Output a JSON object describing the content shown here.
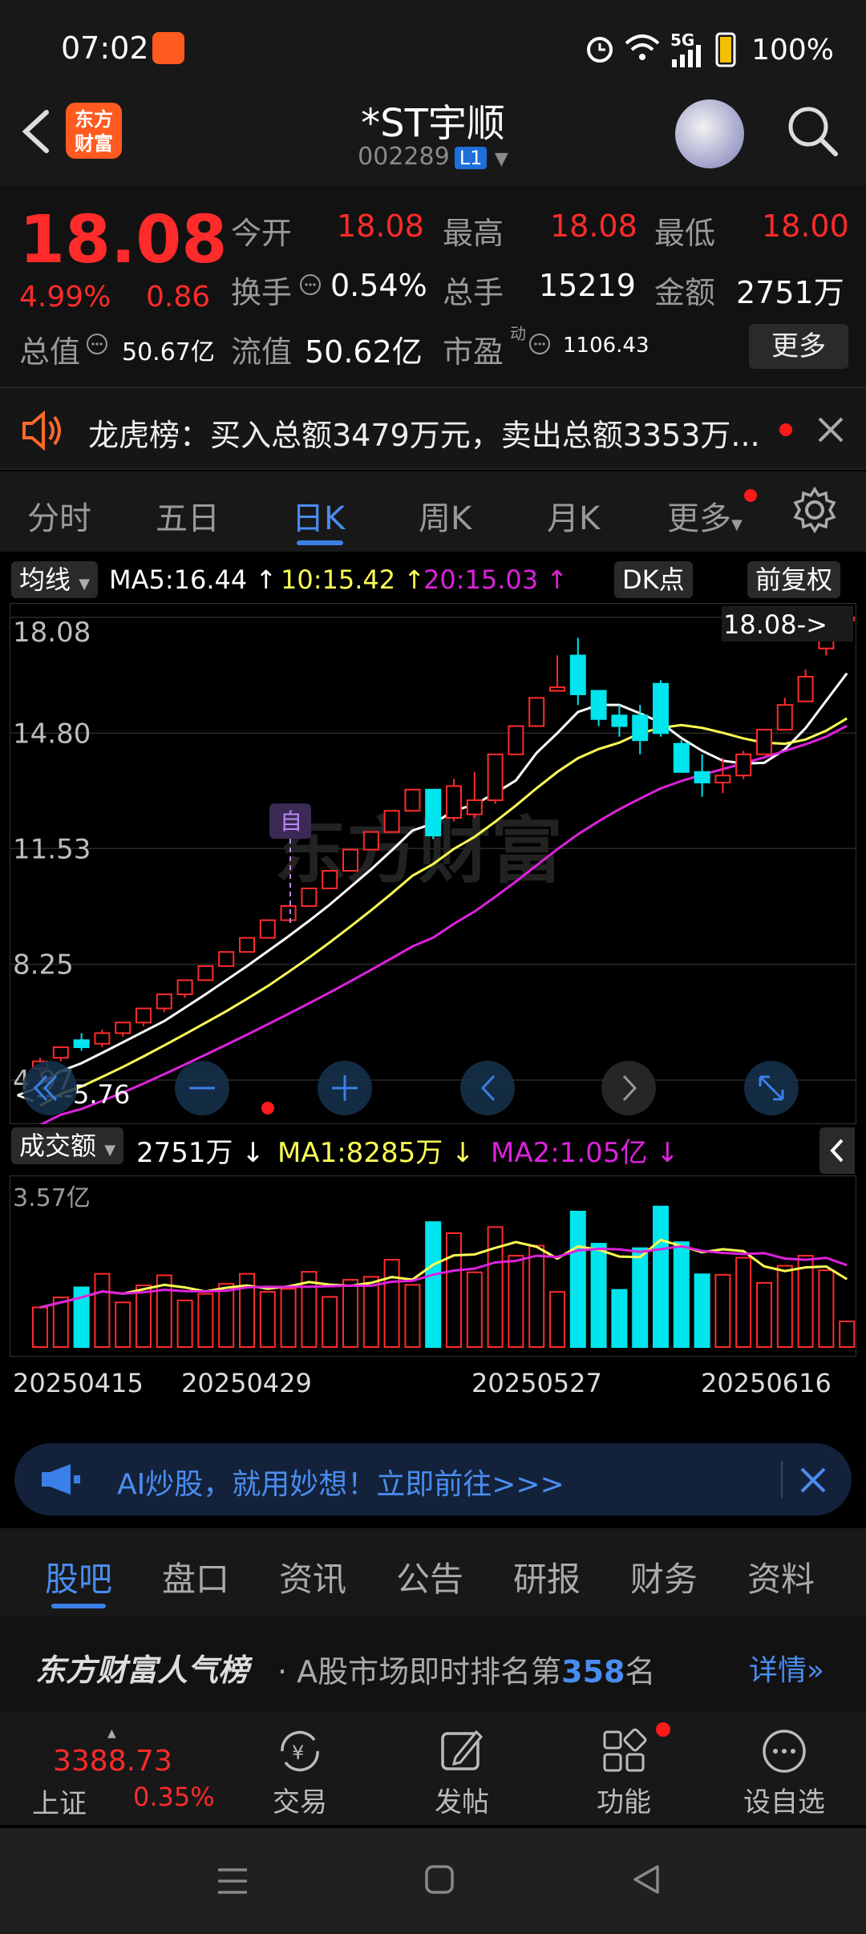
{
  "status": {
    "time": "07:02",
    "network": "5G",
    "battery": "100%"
  },
  "header": {
    "logo_line1": "东方",
    "logo_line2": "财富",
    "stock_name": "*ST宇顺",
    "stock_code": "002289",
    "level_badge": "L1"
  },
  "quote": {
    "price": "18.08",
    "change_pct": "4.99%",
    "change": "0.86",
    "open_label": "今开",
    "open": "18.08",
    "high_label": "最高",
    "high": "18.08",
    "low_label": "最低",
    "low": "18.00",
    "turnover_label": "换手",
    "turnover": "0.54%",
    "volume_label": "总手",
    "volume": "15219",
    "amount_label": "金额",
    "amount": "2751万",
    "mktcap_label": "总值",
    "mktcap": "50.67亿",
    "float_label": "流值",
    "float_cap": "50.62亿",
    "pe_label": "市盈",
    "pe_sup": "动",
    "pe": "1106.43",
    "more": "更多"
  },
  "notice": {
    "text": "龙虎榜：买入总额3479万元，卖出总额3353万..."
  },
  "tabs": [
    {
      "label": "分时"
    },
    {
      "label": "五日"
    },
    {
      "label": "日K"
    },
    {
      "label": "周K"
    },
    {
      "label": "月K"
    },
    {
      "label": "更多"
    }
  ],
  "ma_row": {
    "ma_select": "均线",
    "ma5": "MA5:16.44",
    "ma10": "10:15.42",
    "ma20": "20:15.03",
    "dk": "DK点",
    "adjust": "前复权"
  },
  "colors": {
    "up": "#ff2b2b",
    "down": "#00e5ee",
    "ma5": "#ffffff",
    "ma10": "#ffff55",
    "ma20": "#dd22dd",
    "accent": "#4a8df0"
  },
  "chart_data": {
    "type": "candlestick",
    "y_labels": [
      "18.08",
      "14.80",
      "11.53",
      "8.25",
      "4.97"
    ],
    "ylim": [
      4.97,
      18.08
    ],
    "last_marker": "18.08->",
    "low_marker": "<----5.76",
    "self_marker": "自",
    "watermark": "东方财富",
    "candles": [
      {
        "o": 5.3,
        "h": 5.6,
        "l": 5.1,
        "c": 5.5
      },
      {
        "o": 5.6,
        "h": 5.9,
        "l": 5.5,
        "c": 5.9
      },
      {
        "o": 6.1,
        "h": 6.3,
        "l": 5.8,
        "c": 5.9
      },
      {
        "o": 6.0,
        "h": 6.4,
        "l": 5.9,
        "c": 6.3
      },
      {
        "o": 6.3,
        "h": 6.6,
        "l": 6.2,
        "c": 6.6
      },
      {
        "o": 6.6,
        "h": 7.0,
        "l": 6.5,
        "c": 7.0
      },
      {
        "o": 7.0,
        "h": 7.4,
        "l": 6.9,
        "c": 7.4
      },
      {
        "o": 7.4,
        "h": 7.8,
        "l": 7.3,
        "c": 7.8
      },
      {
        "o": 7.8,
        "h": 8.2,
        "l": 7.8,
        "c": 8.2
      },
      {
        "o": 8.2,
        "h": 8.6,
        "l": 8.2,
        "c": 8.6
      },
      {
        "o": 8.6,
        "h": 9.0,
        "l": 8.6,
        "c": 9.0
      },
      {
        "o": 9.0,
        "h": 9.5,
        "l": 9.0,
        "c": 9.5
      },
      {
        "o": 9.5,
        "h": 9.9,
        "l": 9.5,
        "c": 9.9
      },
      {
        "o": 9.9,
        "h": 10.4,
        "l": 9.9,
        "c": 10.4
      },
      {
        "o": 10.4,
        "h": 10.9,
        "l": 10.4,
        "c": 10.9
      },
      {
        "o": 10.9,
        "h": 11.5,
        "l": 10.9,
        "c": 11.5
      },
      {
        "o": 11.5,
        "h": 12.0,
        "l": 11.5,
        "c": 12.0
      },
      {
        "o": 12.0,
        "h": 12.6,
        "l": 12.0,
        "c": 12.6
      },
      {
        "o": 12.6,
        "h": 13.2,
        "l": 12.6,
        "c": 13.2
      },
      {
        "o": 13.2,
        "h": 13.2,
        "l": 11.8,
        "c": 11.9
      },
      {
        "o": 12.4,
        "h": 13.5,
        "l": 12.3,
        "c": 13.3
      },
      {
        "o": 12.5,
        "h": 13.7,
        "l": 12.4,
        "c": 12.9
      },
      {
        "o": 12.9,
        "h": 14.2,
        "l": 12.8,
        "c": 14.2
      },
      {
        "o": 14.2,
        "h": 15.0,
        "l": 14.2,
        "c": 15.0
      },
      {
        "o": 15.0,
        "h": 15.8,
        "l": 15.0,
        "c": 15.8
      },
      {
        "o": 16.0,
        "h": 17.0,
        "l": 16.1,
        "c": 16.1
      },
      {
        "o": 17.0,
        "h": 17.5,
        "l": 15.6,
        "c": 15.9
      },
      {
        "o": 16.0,
        "h": 16.0,
        "l": 15.0,
        "c": 15.2
      },
      {
        "o": 15.3,
        "h": 15.6,
        "l": 14.7,
        "c": 15.0
      },
      {
        "o": 15.3,
        "h": 15.6,
        "l": 14.2,
        "c": 14.6
      },
      {
        "o": 16.2,
        "h": 16.3,
        "l": 14.7,
        "c": 14.8
      },
      {
        "o": 14.5,
        "h": 14.6,
        "l": 13.7,
        "c": 13.7
      },
      {
        "o": 13.7,
        "h": 14.2,
        "l": 13.0,
        "c": 13.4
      },
      {
        "o": 13.4,
        "h": 14.1,
        "l": 13.1,
        "c": 13.6
      },
      {
        "o": 13.6,
        "h": 14.3,
        "l": 13.5,
        "c": 14.2
      },
      {
        "o": 14.2,
        "h": 14.9,
        "l": 14.2,
        "c": 14.9
      },
      {
        "o": 14.9,
        "h": 15.8,
        "l": 14.9,
        "c": 15.6
      },
      {
        "o": 15.7,
        "h": 16.6,
        "l": 15.7,
        "c": 16.4
      },
      {
        "o": 17.2,
        "h": 17.6,
        "l": 17.0,
        "c": 17.5
      },
      {
        "o": 18.0,
        "h": 18.08,
        "l": 18.0,
        "c": 18.08
      }
    ],
    "volume_title": "成交额",
    "volume_now": "2751万",
    "vol_ma1": "MA1:8285万",
    "vol_ma2": "MA2:1.05亿",
    "volume_max_label": "3.57亿",
    "x_labels": [
      "20250415",
      "20250429",
      "20250527",
      "20250616"
    ]
  },
  "ai_banner": {
    "text": "AI炒股，就用妙想！立即前往>>>"
  },
  "bottom_tabs": [
    {
      "label": "股吧"
    },
    {
      "label": "盘口"
    },
    {
      "label": "资讯"
    },
    {
      "label": "公告"
    },
    {
      "label": "研报"
    },
    {
      "label": "财务"
    },
    {
      "label": "资料"
    }
  ],
  "rank": {
    "brand": "东方财富人气榜",
    "prefix": "· A股市场即时排名第",
    "number": "358",
    "suffix": "名",
    "detail": "详情"
  },
  "bottom_nav": {
    "index_value": "3388.73",
    "index_name": "上证",
    "index_pct": "0.35%",
    "items": [
      {
        "label": "交易"
      },
      {
        "label": "发帖"
      },
      {
        "label": "功能"
      },
      {
        "label": "设自选"
      }
    ]
  }
}
